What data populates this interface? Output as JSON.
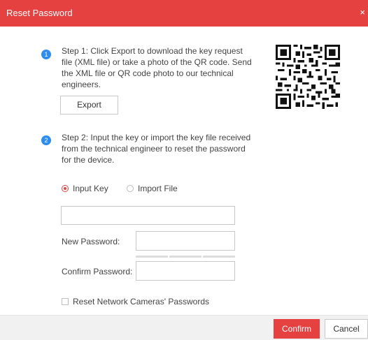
{
  "dialog": {
    "title": "Reset Password",
    "close_symbol": "×"
  },
  "step1": {
    "badge": "1",
    "lines": [
      "Step 1: Click Export to download the key request",
      "file (XML file) or take a photo of the QR code. Send",
      "the XML file or QR code photo to our technical",
      "engineers."
    ],
    "export_label": "Export"
  },
  "qr_code": {
    "icon": "qr-code-icon"
  },
  "step2": {
    "badge": "2",
    "lines": [
      "Step 2: Input the key or import the key file received",
      "from the technical engineer to reset the password",
      "for the device."
    ]
  },
  "mode": {
    "input_key_label": "Input Key",
    "import_file_label": "Import File",
    "selected": "Input Key"
  },
  "form": {
    "key_value": "",
    "new_password_label": "New Password:",
    "new_password_value": "",
    "confirm_password_label": "Confirm Password:",
    "confirm_password_value": "",
    "reset_cameras_label": "Reset Network Cameras' Passwords",
    "reset_cameras_checked": false
  },
  "footer": {
    "confirm_label": "Confirm",
    "cancel_label": "Cancel"
  },
  "colors": {
    "accent": "#e64141",
    "step_badge": "#2c8cf0",
    "footer_bg": "#f1f1f1"
  }
}
